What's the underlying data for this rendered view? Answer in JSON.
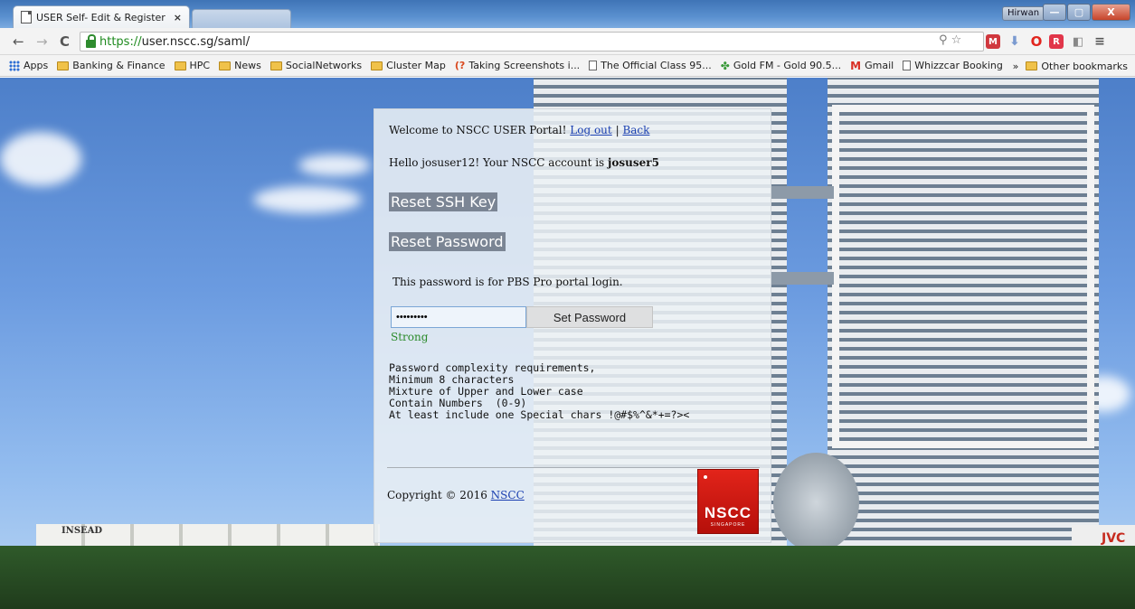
{
  "browser": {
    "tab_title": "USER Self- Edit & Register",
    "tab_close": "×",
    "user_badge": "Hirwan",
    "url_scheme": "https://",
    "url_rest": "user.nscc.sg/saml/",
    "back": "←",
    "forward": "→",
    "reload": "C",
    "minimize": "—",
    "maximize": "▢",
    "close": "X"
  },
  "bookmarks": {
    "apps": "Apps",
    "items": [
      "Banking & Finance",
      "HPC",
      "News",
      "SocialNetworks",
      "Cluster Map",
      "Taking Screenshots i...",
      "The Official Class 95...",
      "Gold FM - Gold 90.5...",
      "Gmail",
      "Whizzcar Booking"
    ],
    "overflow": "»",
    "other": "Other bookmarks"
  },
  "portal": {
    "welcome": "Welcome to NSCC USER Portal!",
    "logout": "Log out",
    "separator": "|",
    "back": "Back",
    "hello_prefix": "Hello josuser12! Your NSCC account is",
    "account": "josuser5",
    "reset_ssh": "Reset SSH Key",
    "reset_password": "Reset Password",
    "pbs_note": "This password is for PBS Pro portal login.",
    "password_value": "•••••••••",
    "set_password": "Set Password",
    "strength": "Strong",
    "requirements": "Password complexity requirements,\nMinimum 8 characters\nMixture of Upper and Lower case\nContain Numbers  (0-9)\nAt least include one Special chars !@#$%^&*+=?><",
    "copyright": "Copyright © 2016",
    "copyright_link": "NSCC",
    "logo_main": "NSCC",
    "logo_sub": "SINGAPORE"
  },
  "scene": {
    "sign_left": "INSEAD",
    "sign_right": "JVC"
  },
  "colors": {
    "strength": "#2a8a2a",
    "link": "#1a3fb0",
    "heading_bg": "#7b8594",
    "logo_red": "#e2241a"
  }
}
